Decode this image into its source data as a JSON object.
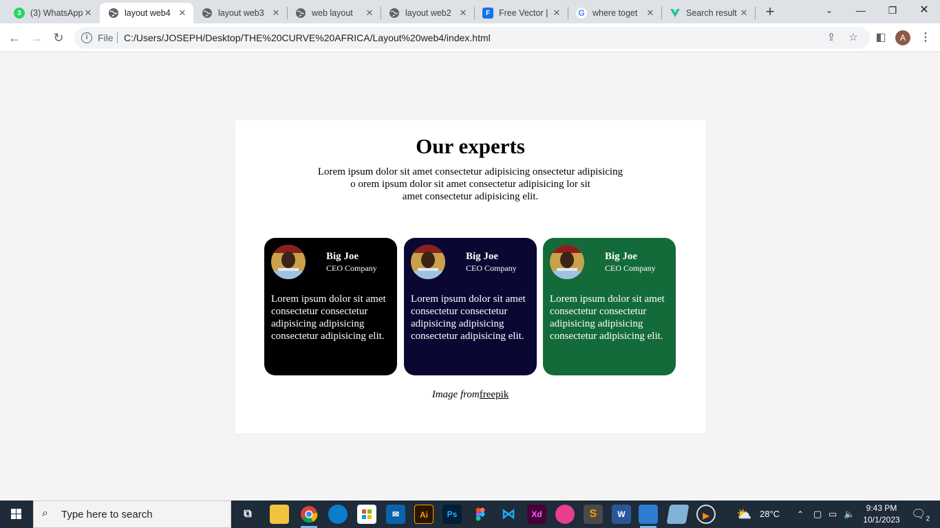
{
  "browser": {
    "tabs": [
      {
        "title": "(3) WhatsApp",
        "favicon": "whatsapp-icon",
        "active": false
      },
      {
        "title": "layout web4",
        "favicon": "globe-icon",
        "active": true
      },
      {
        "title": "layout web3",
        "favicon": "globe-icon",
        "active": false
      },
      {
        "title": "web layout",
        "favicon": "globe-icon",
        "active": false
      },
      {
        "title": "layout web2",
        "favicon": "globe-icon",
        "active": false
      },
      {
        "title": "Free Vector |",
        "favicon": "freepik-icon",
        "active": false
      },
      {
        "title": "where toget",
        "favicon": "google-icon",
        "active": false
      },
      {
        "title": "Search result",
        "favicon": "vuetify-icon",
        "active": false
      }
    ],
    "whatsapp_badge": "3",
    "address_scheme": "File",
    "url": "C:/Users/JOSEPH/Desktop/THE%20CURVE%20AFRICA/Layout%20web4/index.html",
    "profile_initial": "A"
  },
  "page": {
    "heading": "Our experts",
    "intro_lines": [
      "Lorem ipsum dolor sit amet consectetur adipisicing onsectetur adipisicing",
      "o orem ipsum dolor sit amet consectetur adipisicing lor sit",
      "amet consectetur adipisicing elit."
    ],
    "cards": [
      {
        "name": "Big Joe",
        "role": "CEO Company",
        "bio": "Lorem ipsum dolor sit amet consectetur consectetur adipisicing adipisicing consectetur adipisicing elit.",
        "color": "#000000"
      },
      {
        "name": "Big Joe",
        "role": "CEO Company",
        "bio": "Lorem ipsum dolor sit amet consectetur consectetur adipisicing adipisicing consectetur adipisicing elit.",
        "color": "#0a0733"
      },
      {
        "name": "Big Joe",
        "role": "CEO Company",
        "bio": "Lorem ipsum dolor sit amet consectetur consectetur adipisicing adipisicing consectetur adipisicing elit.",
        "color": "#146b3a"
      }
    ],
    "credit_text": "Image from",
    "credit_link": "freepik"
  },
  "taskbar": {
    "search_placeholder": "Type here to search",
    "weather_temp": "28°C",
    "time": "9:43 PM",
    "date": "10/1/2023",
    "notification_count": "2",
    "apps": [
      {
        "name": "task-view-icon",
        "label": ""
      },
      {
        "name": "file-explorer-icon",
        "label": ""
      },
      {
        "name": "chrome-icon",
        "label": ""
      },
      {
        "name": "edge-icon",
        "label": ""
      },
      {
        "name": "store-icon",
        "label": ""
      },
      {
        "name": "mail-icon",
        "label": ""
      },
      {
        "name": "illustrator-icon",
        "label": "Ai"
      },
      {
        "name": "photoshop-icon",
        "label": "Ps"
      },
      {
        "name": "figma-icon",
        "label": ""
      },
      {
        "name": "vscode-icon",
        "label": ""
      },
      {
        "name": "adobe-xd-icon",
        "label": "Xd"
      },
      {
        "name": "wps-icon",
        "label": ""
      },
      {
        "name": "sublime-text-icon",
        "label": "S"
      },
      {
        "name": "word-icon",
        "label": "W"
      },
      {
        "name": "paint-app-icon",
        "label": ""
      },
      {
        "name": "notes-app-icon",
        "label": ""
      },
      {
        "name": "media-player-icon",
        "label": ""
      }
    ]
  },
  "colors": {
    "page_bg": "#f4f4f4",
    "taskbar_bg": "#1e2b38",
    "chrome_bg": "#dee1e6"
  }
}
